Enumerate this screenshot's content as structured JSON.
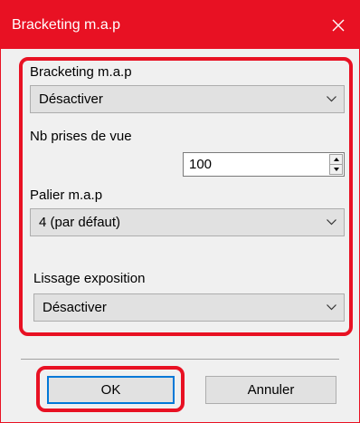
{
  "window": {
    "title": "Bracketing m.a.p",
    "close_icon": "close-icon",
    "titlebar_color": "#e81123"
  },
  "form": {
    "bracketing": {
      "label": "Bracketing m.a.p",
      "value": "Désactiver"
    },
    "shots": {
      "label": "Nb prises de vue",
      "value": "100"
    },
    "step": {
      "label": "Palier m.a.p",
      "value": "4 (par défaut)"
    },
    "smoothing": {
      "label": "Lissage exposition",
      "value": "Désactiver"
    }
  },
  "buttons": {
    "ok": "OK",
    "cancel": "Annuler"
  },
  "annotations": {
    "highlight_color": "#e81123"
  }
}
